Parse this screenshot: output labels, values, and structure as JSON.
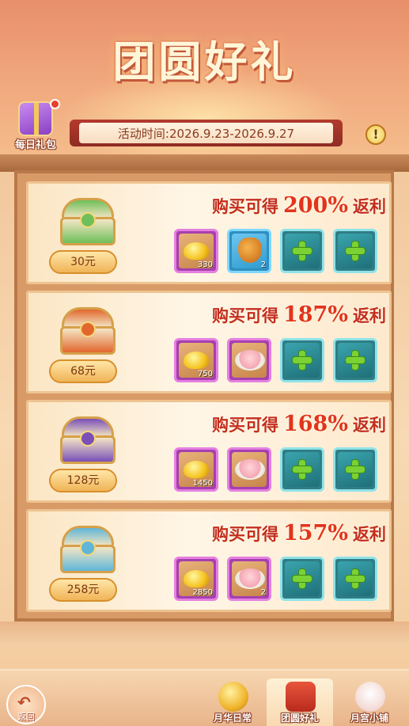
{
  "title": "团圆好礼",
  "daily_gift": {
    "label": "每日礼包"
  },
  "activity_time": "活动时间:2026.9.23-2026.9.27",
  "info_icon": "exclamation-icon",
  "colors": {
    "accent": "#c42d1d",
    "plus": "#7bd234",
    "frame": "#d89a67"
  },
  "packs": [
    {
      "price": "30元",
      "chest_color": "#6fbf5a",
      "slogan_pre": "购买可得",
      "percent": "200%",
      "slogan_post": "返利",
      "items": [
        {
          "icon": "gold-ingot-icon",
          "count": "330",
          "rarity": "purple"
        },
        {
          "icon": "money-bag-icon",
          "count": "2",
          "rarity": "blue"
        },
        {
          "icon": "plus-icon",
          "count": "",
          "rarity": "teal"
        },
        {
          "icon": "plus-icon",
          "count": "",
          "rarity": "teal"
        }
      ]
    },
    {
      "price": "68元",
      "chest_color": "#e2672e",
      "slogan_pre": "购买可得",
      "percent": "187%",
      "slogan_post": "返利",
      "items": [
        {
          "icon": "gold-ingot-icon",
          "count": "750",
          "rarity": "purple"
        },
        {
          "icon": "mooncake-icon",
          "count": "",
          "rarity": "purple"
        },
        {
          "icon": "plus-icon",
          "count": "",
          "rarity": "teal"
        },
        {
          "icon": "plus-icon",
          "count": "",
          "rarity": "teal"
        }
      ]
    },
    {
      "price": "128元",
      "chest_color": "#7a4fb8",
      "slogan_pre": "购买可得",
      "percent": "168%",
      "slogan_post": "返利",
      "items": [
        {
          "icon": "gold-ingot-icon",
          "count": "1450",
          "rarity": "purple"
        },
        {
          "icon": "mooncake-icon",
          "count": "",
          "rarity": "purple"
        },
        {
          "icon": "plus-icon",
          "count": "",
          "rarity": "teal"
        },
        {
          "icon": "plus-icon",
          "count": "",
          "rarity": "teal"
        }
      ]
    },
    {
      "price": "258元",
      "chest_color": "#5fb6d8",
      "slogan_pre": "购买可得",
      "percent": "157%",
      "slogan_post": "返利",
      "items": [
        {
          "icon": "gold-ingot-icon",
          "count": "2850",
          "rarity": "purple"
        },
        {
          "icon": "mooncake-icon",
          "count": "2",
          "rarity": "purple"
        },
        {
          "icon": "plus-icon",
          "count": "",
          "rarity": "teal"
        },
        {
          "icon": "plus-icon",
          "count": "",
          "rarity": "teal"
        }
      ]
    }
  ],
  "nav": {
    "back_label": "返回",
    "tabs": [
      {
        "label": "月华日常",
        "icon": "mooncake-coin-icon",
        "active": false
      },
      {
        "label": "团圆好礼",
        "icon": "gift-box-icon",
        "active": true
      },
      {
        "label": "月宫小铺",
        "icon": "rabbit-icon",
        "active": false
      }
    ]
  }
}
